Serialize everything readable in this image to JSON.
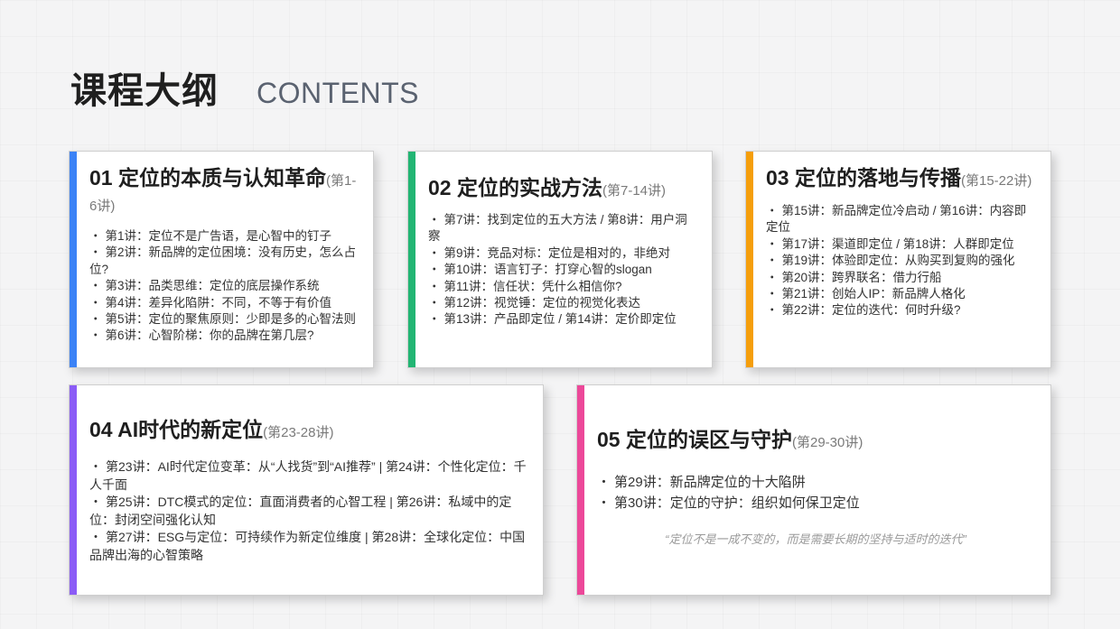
{
  "header": {
    "title_cn": "课程大纲",
    "title_en": "CONTENTS"
  },
  "colors": {
    "card1": "#3b82f6",
    "card2": "#22b573",
    "card3": "#f59e0b",
    "card4": "#8b5cf6",
    "card5": "#ec4899"
  },
  "bullet": "・",
  "cards": [
    {
      "title": "01  定位的本质与认知革命",
      "range": "(第1-6讲)",
      "items": [
        "第1讲：定位不是广告语，是心智中的钉子",
        "第2讲：新品牌的定位困境：没有历史，怎么占位?",
        "第3讲：品类思维：定位的底层操作系统",
        "第4讲：差异化陷阱：不同，不等于有价值",
        "第5讲：定位的聚焦原则：少即是多的心智法则",
        "第6讲：心智阶梯：你的品牌在第几层?"
      ]
    },
    {
      "title": "02  定位的实战方法",
      "range": "(第7-14讲)",
      "items": [
        "第7讲：找到定位的五大方法 / 第8讲：用户洞察",
        "第9讲：竞品对标：定位是相对的，非绝对",
        "第10讲：语言钉子：打穿心智的slogan",
        "第11讲：信任状：凭什么相信你?",
        "第12讲：视觉锤：定位的视觉化表达",
        "第13讲：产品即定位 / 第14讲：定价即定位"
      ]
    },
    {
      "title": "03  定位的落地与传播",
      "range": "(第15-22讲)",
      "items": [
        "第15讲：新品牌定位冷启动 / 第16讲：内容即定位",
        "第17讲：渠道即定位 / 第18讲：人群即定位",
        "第19讲：体验即定位：从购买到复购的强化",
        "第20讲：跨界联名：借力行船",
        "第21讲：创始人IP：新品牌人格化",
        "第22讲：定位的迭代：何时升级?"
      ]
    },
    {
      "title": "04  AI时代的新定位",
      "range": "(第23-28讲)",
      "items": [
        "第23讲：AI时代定位变革：从“人找货”到“AI推荐” | 第24讲：个性化定位：千人千面",
        "第25讲：DTC模式的定位：直面消费者的心智工程 | 第26讲：私域中的定位：封闭空间强化认知",
        "第27讲：ESG与定位：可持续作为新定位维度 | 第28讲：全球化定位：中国品牌出海的心智策略"
      ]
    },
    {
      "title": "05  定位的误区与守护",
      "range": "(第29-30讲)",
      "items": [
        "第29讲：新品牌定位的十大陷阱",
        "第30讲：定位的守护：组织如何保卫定位"
      ],
      "quote": "“定位不是一成不变的，而是需要长期的坚持与适时的迭代”"
    }
  ]
}
